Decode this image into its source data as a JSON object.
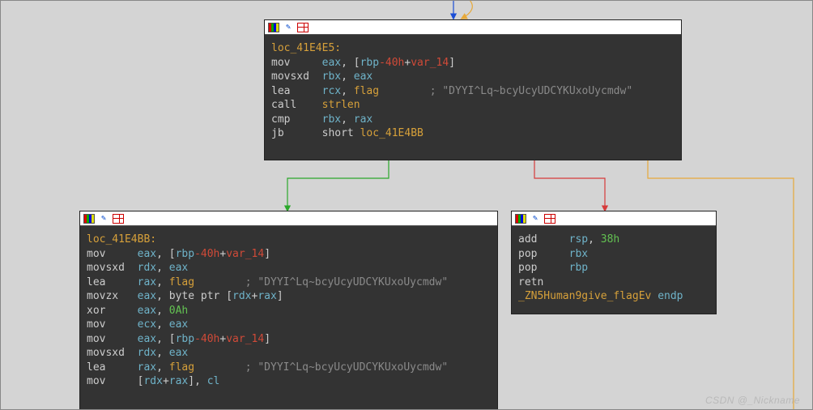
{
  "watermark": "CSDN @_Nickname",
  "icons": {
    "colors": "color-swatch-icon",
    "pencil": "pencil-icon",
    "table": "table-icon"
  },
  "nodes": {
    "top": {
      "label": "loc_41E4E5:",
      "lines": [
        {
          "m": "mov",
          "r1": "eax",
          "p1": ", [",
          "r2": "rbp",
          "off": "-40h",
          "p2": "+",
          "var": "var_14",
          "p3": "]"
        },
        {
          "m": "movsxd",
          "r1": "rbx",
          "p1": ", ",
          "r2": "eax"
        },
        {
          "m": "lea",
          "r1": "rcx",
          "p1": ", ",
          "sym": "flag",
          "cmt": "        ; \"DYYI^Lq~bcyUcyUDCYKUxoUycmdw\""
        },
        {
          "m": "call",
          "fn": "strlen"
        },
        {
          "m": "cmp",
          "r1": "rbx",
          "p1": ", ",
          "r2": "rax"
        },
        {
          "m": "jb",
          "tgt_pref": "short ",
          "tgt": "loc_41E4BB"
        }
      ]
    },
    "left": {
      "label": "loc_41E4BB:",
      "lines": [
        {
          "m": "mov",
          "r1": "eax",
          "p1": ", [",
          "r2": "rbp",
          "off": "-40h",
          "p2": "+",
          "var": "var_14",
          "p3": "]"
        },
        {
          "m": "movsxd",
          "r1": "rdx",
          "p1": ", ",
          "r2": "eax"
        },
        {
          "m": "lea",
          "r1": "rax",
          "p1": ", ",
          "sym": "flag",
          "cmt": "        ; \"DYYI^Lq~bcyUcyUDCYKUxoUycmdw\""
        },
        {
          "m": "movzx",
          "r1": "eax",
          "p1": ", byte ptr [",
          "r2": "rdx",
          "p2": "+",
          "r3": "rax",
          "p3": "]"
        },
        {
          "m": "xor",
          "r1": "eax",
          "p1": ", ",
          "num": "0Ah"
        },
        {
          "m": "mov",
          "r1": "ecx",
          "p1": ", ",
          "r2": "eax"
        },
        {
          "m": "mov",
          "r1": "eax",
          "p1": ", [",
          "r2": "rbp",
          "off": "-40h",
          "p2": "+",
          "var": "var_14",
          "p3": "]"
        },
        {
          "m": "movsxd",
          "r1": "rdx",
          "p1": ", ",
          "r2": "eax"
        },
        {
          "m": "lea",
          "r1": "rax",
          "p1": ", ",
          "sym": "flag",
          "cmt": "        ; \"DYYI^Lq~bcyUcyUDCYKUxoUycmdw\""
        },
        {
          "m": "mov",
          "p0": "[",
          "r1": "rdx",
          "p1": "+",
          "r2": "rax",
          "p2": "], ",
          "r3": "cl"
        }
      ]
    },
    "right": {
      "lines": [
        {
          "m": "add",
          "r1": "rsp",
          "p1": ", ",
          "num": "38h"
        },
        {
          "m": "pop",
          "r1": "rbx"
        },
        {
          "m": "pop",
          "r1": "rbp"
        },
        {
          "m": "retn"
        }
      ],
      "endp_name": "_ZN5Human9give_flagEv",
      "endp_kw": "endp"
    }
  }
}
